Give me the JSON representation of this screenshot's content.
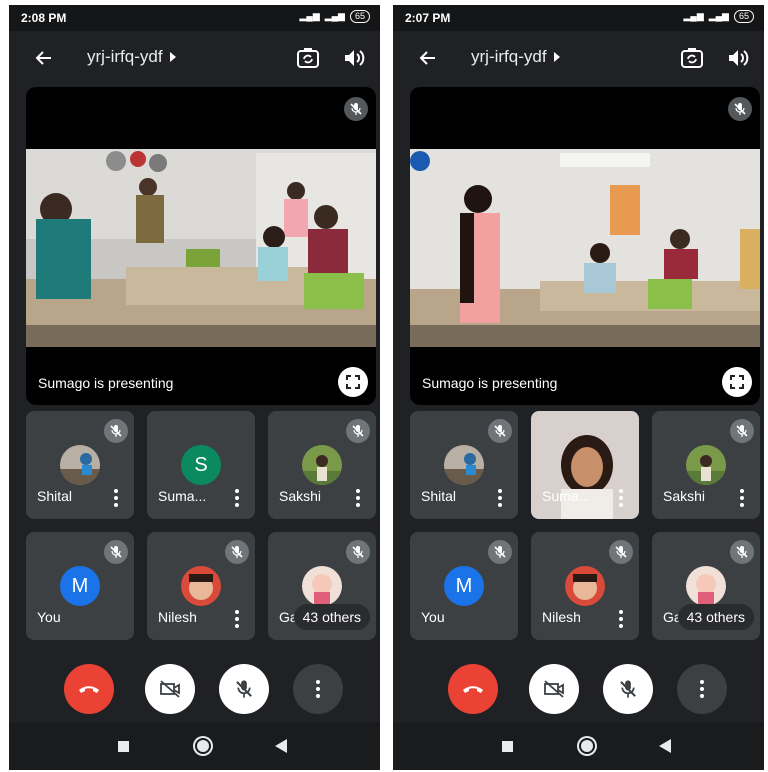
{
  "screens": [
    {
      "status": {
        "time": "2:08 PM",
        "battery": "65"
      },
      "meeting": {
        "code": "yrj-irfq-ydf"
      },
      "presentation": {
        "label": "Sumago is presenting"
      },
      "tiles": [
        {
          "name": "Shital"
        },
        {
          "name": "Suma...",
          "initial": "S"
        },
        {
          "name": "Sakshi"
        },
        {
          "name": "You",
          "initial": "M"
        },
        {
          "name": "Nilesh"
        },
        {
          "name": "Ga"
        }
      ],
      "others": "43 others"
    },
    {
      "status": {
        "time": "2:07 PM",
        "battery": "65"
      },
      "meeting": {
        "code": "yrj-irfq-ydf"
      },
      "presentation": {
        "label": "Sumago is presenting"
      },
      "tiles": [
        {
          "name": "Shital"
        },
        {
          "name": "Suma..."
        },
        {
          "name": "Sakshi"
        },
        {
          "name": "You",
          "initial": "M"
        },
        {
          "name": "Nilesh"
        },
        {
          "name": "Ga"
        }
      ],
      "others": "43 others"
    }
  ],
  "colors": {
    "background": "#202124",
    "tile": "#3c4043",
    "end_call": "#ea4335",
    "avatar_green": "#0b8a5f",
    "avatar_blue": "#1a73e8",
    "active_border": "#1a73e8"
  },
  "icons": [
    "back-arrow-icon",
    "play-arrow-icon",
    "switch-camera-icon",
    "speaker-icon",
    "mic-off-icon",
    "fullscreen-icon",
    "more-vert-icon",
    "end-call-icon",
    "camera-off-icon",
    "stop-icon",
    "home-icon",
    "back-triangle-icon"
  ]
}
